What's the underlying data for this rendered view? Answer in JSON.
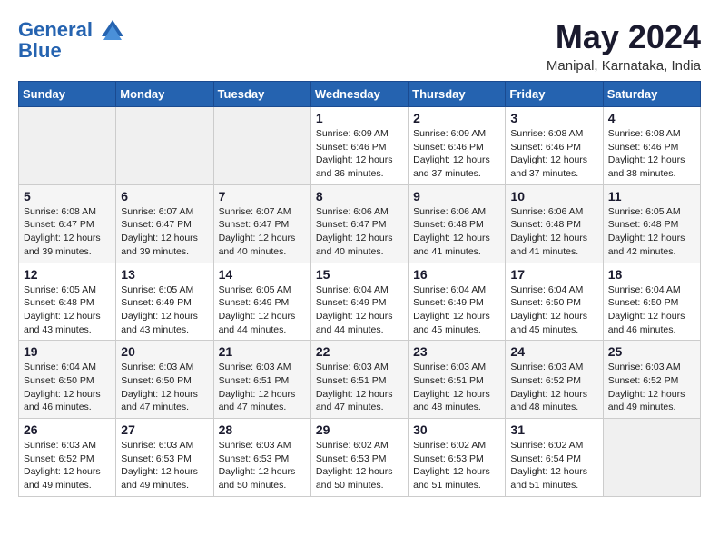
{
  "header": {
    "logo_line1": "General",
    "logo_line2": "Blue",
    "month_title": "May 2024",
    "location": "Manipal, Karnataka, India"
  },
  "days_of_week": [
    "Sunday",
    "Monday",
    "Tuesday",
    "Wednesday",
    "Thursday",
    "Friday",
    "Saturday"
  ],
  "weeks": [
    [
      {
        "day": "",
        "info": ""
      },
      {
        "day": "",
        "info": ""
      },
      {
        "day": "",
        "info": ""
      },
      {
        "day": "1",
        "info": "Sunrise: 6:09 AM\nSunset: 6:46 PM\nDaylight: 12 hours\nand 36 minutes."
      },
      {
        "day": "2",
        "info": "Sunrise: 6:09 AM\nSunset: 6:46 PM\nDaylight: 12 hours\nand 37 minutes."
      },
      {
        "day": "3",
        "info": "Sunrise: 6:08 AM\nSunset: 6:46 PM\nDaylight: 12 hours\nand 37 minutes."
      },
      {
        "day": "4",
        "info": "Sunrise: 6:08 AM\nSunset: 6:46 PM\nDaylight: 12 hours\nand 38 minutes."
      }
    ],
    [
      {
        "day": "5",
        "info": "Sunrise: 6:08 AM\nSunset: 6:47 PM\nDaylight: 12 hours\nand 39 minutes."
      },
      {
        "day": "6",
        "info": "Sunrise: 6:07 AM\nSunset: 6:47 PM\nDaylight: 12 hours\nand 39 minutes."
      },
      {
        "day": "7",
        "info": "Sunrise: 6:07 AM\nSunset: 6:47 PM\nDaylight: 12 hours\nand 40 minutes."
      },
      {
        "day": "8",
        "info": "Sunrise: 6:06 AM\nSunset: 6:47 PM\nDaylight: 12 hours\nand 40 minutes."
      },
      {
        "day": "9",
        "info": "Sunrise: 6:06 AM\nSunset: 6:48 PM\nDaylight: 12 hours\nand 41 minutes."
      },
      {
        "day": "10",
        "info": "Sunrise: 6:06 AM\nSunset: 6:48 PM\nDaylight: 12 hours\nand 41 minutes."
      },
      {
        "day": "11",
        "info": "Sunrise: 6:05 AM\nSunset: 6:48 PM\nDaylight: 12 hours\nand 42 minutes."
      }
    ],
    [
      {
        "day": "12",
        "info": "Sunrise: 6:05 AM\nSunset: 6:48 PM\nDaylight: 12 hours\nand 43 minutes."
      },
      {
        "day": "13",
        "info": "Sunrise: 6:05 AM\nSunset: 6:49 PM\nDaylight: 12 hours\nand 43 minutes."
      },
      {
        "day": "14",
        "info": "Sunrise: 6:05 AM\nSunset: 6:49 PM\nDaylight: 12 hours\nand 44 minutes."
      },
      {
        "day": "15",
        "info": "Sunrise: 6:04 AM\nSunset: 6:49 PM\nDaylight: 12 hours\nand 44 minutes."
      },
      {
        "day": "16",
        "info": "Sunrise: 6:04 AM\nSunset: 6:49 PM\nDaylight: 12 hours\nand 45 minutes."
      },
      {
        "day": "17",
        "info": "Sunrise: 6:04 AM\nSunset: 6:50 PM\nDaylight: 12 hours\nand 45 minutes."
      },
      {
        "day": "18",
        "info": "Sunrise: 6:04 AM\nSunset: 6:50 PM\nDaylight: 12 hours\nand 46 minutes."
      }
    ],
    [
      {
        "day": "19",
        "info": "Sunrise: 6:04 AM\nSunset: 6:50 PM\nDaylight: 12 hours\nand 46 minutes."
      },
      {
        "day": "20",
        "info": "Sunrise: 6:03 AM\nSunset: 6:50 PM\nDaylight: 12 hours\nand 47 minutes."
      },
      {
        "day": "21",
        "info": "Sunrise: 6:03 AM\nSunset: 6:51 PM\nDaylight: 12 hours\nand 47 minutes."
      },
      {
        "day": "22",
        "info": "Sunrise: 6:03 AM\nSunset: 6:51 PM\nDaylight: 12 hours\nand 47 minutes."
      },
      {
        "day": "23",
        "info": "Sunrise: 6:03 AM\nSunset: 6:51 PM\nDaylight: 12 hours\nand 48 minutes."
      },
      {
        "day": "24",
        "info": "Sunrise: 6:03 AM\nSunset: 6:52 PM\nDaylight: 12 hours\nand 48 minutes."
      },
      {
        "day": "25",
        "info": "Sunrise: 6:03 AM\nSunset: 6:52 PM\nDaylight: 12 hours\nand 49 minutes."
      }
    ],
    [
      {
        "day": "26",
        "info": "Sunrise: 6:03 AM\nSunset: 6:52 PM\nDaylight: 12 hours\nand 49 minutes."
      },
      {
        "day": "27",
        "info": "Sunrise: 6:03 AM\nSunset: 6:53 PM\nDaylight: 12 hours\nand 49 minutes."
      },
      {
        "day": "28",
        "info": "Sunrise: 6:03 AM\nSunset: 6:53 PM\nDaylight: 12 hours\nand 50 minutes."
      },
      {
        "day": "29",
        "info": "Sunrise: 6:02 AM\nSunset: 6:53 PM\nDaylight: 12 hours\nand 50 minutes."
      },
      {
        "day": "30",
        "info": "Sunrise: 6:02 AM\nSunset: 6:53 PM\nDaylight: 12 hours\nand 51 minutes."
      },
      {
        "day": "31",
        "info": "Sunrise: 6:02 AM\nSunset: 6:54 PM\nDaylight: 12 hours\nand 51 minutes."
      },
      {
        "day": "",
        "info": ""
      }
    ]
  ]
}
